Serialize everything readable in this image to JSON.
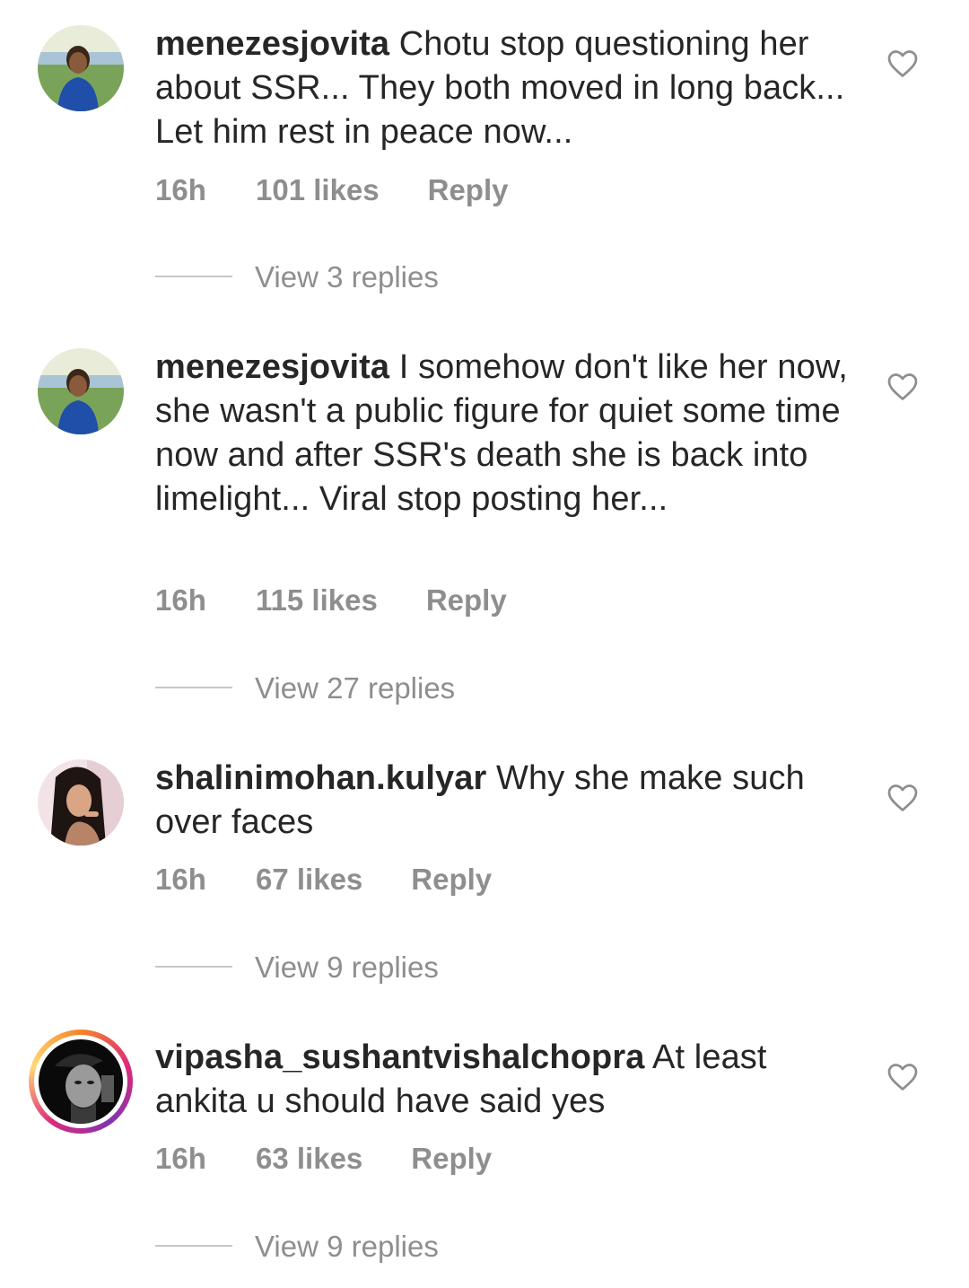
{
  "comments": [
    {
      "username": "menezesjovita",
      "text": " Chotu stop questioning her about SSR... They both moved in long back... Let him rest in peace now...",
      "time": "16h",
      "likes": "101 likes",
      "reply": "Reply",
      "view_replies": "View 3 replies",
      "avatar_icon": "profile-photo",
      "like_icon": "heart-outline-icon"
    },
    {
      "username": "menezesjovita",
      "text": " I somehow don't like her now, she wasn't a public figure for quiet some time now and after SSR's death she is back into limelight... Viral stop posting her...",
      "time": "16h",
      "likes": "115 likes",
      "reply": "Reply",
      "view_replies": "View 27 replies",
      "avatar_icon": "profile-photo",
      "like_icon": "heart-outline-icon"
    },
    {
      "username": "shalinimohan.kulyar",
      "text": " Why she make such over faces",
      "time": "16h",
      "likes": "67 likes",
      "reply": "Reply",
      "view_replies": "View 9 replies",
      "avatar_icon": "profile-photo",
      "like_icon": "heart-outline-icon"
    },
    {
      "username": "vipasha_sushantvishalchopra",
      "text": " At least ankita u should have said yes",
      "time": "16h",
      "likes": "63 likes",
      "reply": "Reply",
      "view_replies": "View 9 replies",
      "avatar_icon": "profile-photo-with-story-ring",
      "like_icon": "heart-outline-icon"
    }
  ],
  "colors": {
    "text": "#262626",
    "secondary": "#8e8e8e",
    "divider": "#c7c7c7",
    "story_ring": [
      "#f58529",
      "#dd2a7b",
      "#8134af",
      "#feda77"
    ]
  }
}
